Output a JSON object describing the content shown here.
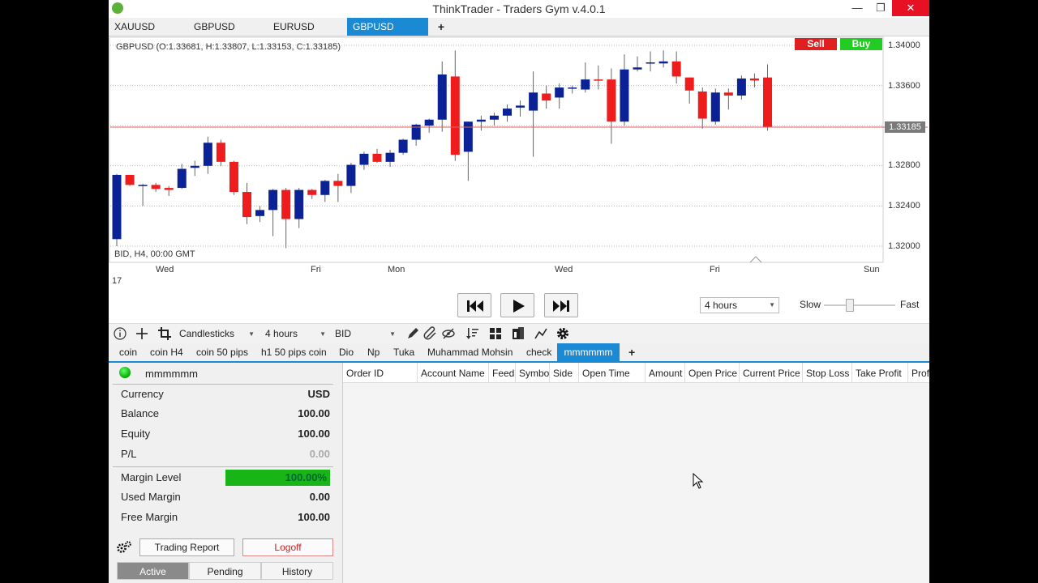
{
  "window": {
    "title": "ThinkTrader - Traders Gym v.4.0.1",
    "minimize": "—",
    "restore": "❐",
    "close": "✕"
  },
  "symbol_tabs": [
    "XAUUSD",
    "GBPUSD",
    "EURUSD",
    "GBPUSD"
  ],
  "symbol_tab_add": "+",
  "chart": {
    "ohlc_text": "GBPUSD (O:1.33681, H:1.33807, L:1.33153, C:1.33185)",
    "bid_info": "BID, H4, 00:00 GMT",
    "bottom_date": "17",
    "sell_label": "Sell",
    "buy_label": "Buy",
    "current_price": "1.33185",
    "day_labels": [
      "Wed",
      "Fri",
      "Mon",
      "Wed",
      "Fri",
      "Sun"
    ]
  },
  "chart_data": {
    "type": "candlestick",
    "symbol": "GBPUSD",
    "timeframe": "H4",
    "y_ticks": [
      "1.34000",
      "1.33600",
      "1.33200",
      "1.32800",
      "1.32400",
      "1.32000"
    ],
    "ylim": [
      1.3186,
      1.3405
    ],
    "current_price": 1.33185,
    "x_labels": [
      "Wed",
      "Fri",
      "Mon",
      "Wed",
      "Fri",
      "Sun"
    ],
    "grid": true,
    "colors": {
      "up": "#0a2296",
      "down": "#ee1c1c",
      "price_line": "#e06060"
    },
    "candles": [
      [
        1.3207,
        1.3272,
        1.32,
        1.3271
      ],
      [
        1.3271,
        1.3266,
        1.326,
        1.3261
      ],
      [
        1.326,
        1.3262,
        1.324,
        1.3261
      ],
      [
        1.3261,
        1.3263,
        1.3254,
        1.3257
      ],
      [
        1.3258,
        1.326,
        1.325,
        1.3256
      ],
      [
        1.3258,
        1.3282,
        1.3257,
        1.3277
      ],
      [
        1.3278,
        1.3285,
        1.327,
        1.328
      ],
      [
        1.328,
        1.3309,
        1.3272,
        1.3303
      ],
      [
        1.3303,
        1.3306,
        1.328,
        1.3284
      ],
      [
        1.3284,
        1.3285,
        1.3251,
        1.3254
      ],
      [
        1.3254,
        1.3263,
        1.3222,
        1.3229
      ],
      [
        1.323,
        1.324,
        1.3224,
        1.3236
      ],
      [
        1.3236,
        1.3257,
        1.321,
        1.3256
      ],
      [
        1.3256,
        1.3258,
        1.3198,
        1.3227
      ],
      [
        1.3227,
        1.3258,
        1.3218,
        1.3256
      ],
      [
        1.3256,
        1.3257,
        1.3247,
        1.3251
      ],
      [
        1.3251,
        1.3266,
        1.3244,
        1.3265
      ],
      [
        1.3265,
        1.3272,
        1.3244,
        1.326
      ],
      [
        1.326,
        1.3283,
        1.3253,
        1.3281
      ],
      [
        1.3281,
        1.3294,
        1.3276,
        1.3292
      ],
      [
        1.3292,
        1.3297,
        1.3283,
        1.3284
      ],
      [
        1.3284,
        1.3296,
        1.3279,
        1.3293
      ],
      [
        1.3293,
        1.3307,
        1.3291,
        1.3306
      ],
      [
        1.3306,
        1.3322,
        1.33,
        1.3321
      ],
      [
        1.332,
        1.3327,
        1.3313,
        1.3326
      ],
      [
        1.3326,
        1.3384,
        1.3314,
        1.3371
      ],
      [
        1.3369,
        1.3395,
        1.3285,
        1.3291
      ],
      [
        1.3294,
        1.3324,
        1.3265,
        1.3324
      ],
      [
        1.3324,
        1.333,
        1.3315,
        1.3326
      ],
      [
        1.3326,
        1.3333,
        1.332,
        1.333
      ],
      [
        1.333,
        1.3341,
        1.3324,
        1.3337
      ],
      [
        1.3338,
        1.3345,
        1.3329,
        1.334
      ],
      [
        1.3335,
        1.3374,
        1.3289,
        1.3353
      ],
      [
        1.3352,
        1.336,
        1.3337,
        1.3345
      ],
      [
        1.3348,
        1.3362,
        1.3337,
        1.3358
      ],
      [
        1.3358,
        1.336,
        1.3352,
        1.3358
      ],
      [
        1.3356,
        1.3383,
        1.3353,
        1.3366
      ],
      [
        1.3366,
        1.338,
        1.3356,
        1.3365
      ],
      [
        1.3366,
        1.3377,
        1.3302,
        1.3324
      ],
      [
        1.3324,
        1.3391,
        1.332,
        1.3376
      ],
      [
        1.3376,
        1.3389,
        1.3374,
        1.3378
      ],
      [
        1.3382,
        1.3394,
        1.3374,
        1.3383
      ],
      [
        1.3382,
        1.3395,
        1.3378,
        1.3384
      ],
      [
        1.3384,
        1.3394,
        1.3362,
        1.3369
      ],
      [
        1.3368,
        1.3362,
        1.3342,
        1.3355
      ],
      [
        1.3354,
        1.3358,
        1.3317,
        1.3327
      ],
      [
        1.3324,
        1.3357,
        1.3321,
        1.3353
      ],
      [
        1.3353,
        1.3357,
        1.3336,
        1.335
      ],
      [
        1.335,
        1.337,
        1.3346,
        1.3367
      ],
      [
        1.3367,
        1.3372,
        1.3358,
        1.3365
      ],
      [
        1.3368,
        1.3381,
        1.3315,
        1.3319
      ]
    ]
  },
  "playback": {
    "speed_select": "4 hours",
    "slow_label": "Slow",
    "fast_label": "Fast",
    "speed_value": 0.35
  },
  "toolbar": {
    "chart_type": "Candlesticks",
    "timeframe": "4 hours",
    "price_type": "BID"
  },
  "account_tabs": [
    "coin",
    "coin H4",
    "coin 50 pips",
    "h1 50 pips coin",
    "Dio",
    "Np",
    "Tuka",
    "Muhammad Mohsin",
    "check",
    "mmmmmm"
  ],
  "account_tab_add": "+",
  "account": {
    "name": "mmmmmm",
    "currency_label": "Currency",
    "currency_value": "USD",
    "balance_label": "Balance",
    "balance_value": "100.00",
    "equity_label": "Equity",
    "equity_value": "100.00",
    "pl_label": "P/L",
    "pl_value": "0.00",
    "margin_level_label": "Margin Level",
    "margin_level_value": "100.00%",
    "used_margin_label": "Used Margin",
    "used_margin_value": "0.00",
    "free_margin_label": "Free Margin",
    "free_margin_value": "100.00",
    "trading_report": "Trading Report",
    "logoff": "Logoff",
    "seg_active": "Active",
    "seg_pending": "Pending",
    "seg_history": "History"
  },
  "orders": {
    "columns": [
      "Order ID",
      "Account Name",
      "Feed",
      "Symbol",
      "Side",
      "Open Time",
      "Amount",
      "Open Price",
      "Current Price",
      "Stop Loss",
      "Take Profit",
      "Profit"
    ]
  }
}
